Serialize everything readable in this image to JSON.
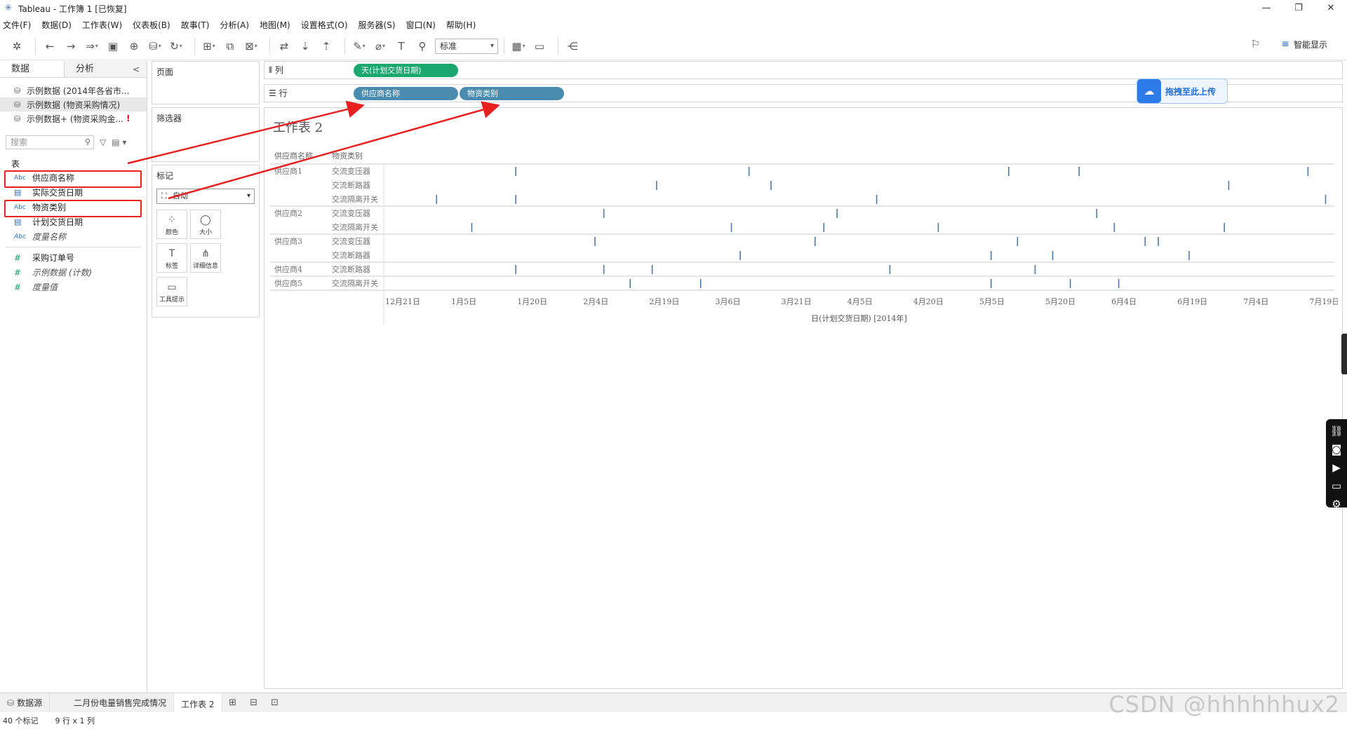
{
  "window": {
    "title": "Tableau - 工作簿 1 [已恢复]",
    "controls": [
      "—",
      "❐",
      "✕"
    ]
  },
  "menu": [
    "文件(F)",
    "数据(D)",
    "工作表(W)",
    "仪表板(B)",
    "故事(T)",
    "分析(A)",
    "地图(M)",
    "设置格式(O)",
    "服务器(S)",
    "窗口(N)",
    "帮助(H)"
  ],
  "toolbar": {
    "fit_select": "标准",
    "smart_show": "智能显示"
  },
  "datapanel": {
    "tab_data": "数据",
    "tab_analysis": "分析",
    "collapse": "<",
    "sources": [
      {
        "label": "示例数据 (2014年各省市...",
        "selected": false,
        "warn": ""
      },
      {
        "label": "示例数据 (物资采购情况)",
        "selected": true,
        "warn": ""
      },
      {
        "label": "示例数据+ (物资采购金...",
        "selected": false,
        "warn": "!"
      }
    ],
    "search_placeholder": "搜索",
    "section": "表",
    "dimensions": [
      {
        "type": "Abc",
        "label": "供应商名称",
        "highlight": true
      },
      {
        "type": "date",
        "label": "实际交货日期",
        "highlight": false
      },
      {
        "type": "Abc",
        "label": "物资类别",
        "highlight": true
      },
      {
        "type": "date",
        "label": "计划交货日期",
        "highlight": false
      },
      {
        "type": "Abc",
        "label": "度量名称",
        "highlight": false,
        "italic": true
      }
    ],
    "measures": [
      {
        "type": "#",
        "label": "采购订单号",
        "italic": false
      },
      {
        "type": "#",
        "label": "示例数据 (计数)",
        "italic": true
      },
      {
        "type": "#",
        "label": "度量值",
        "italic": true
      }
    ]
  },
  "cards": {
    "pages": "页面",
    "filters": "筛选器",
    "marks": "标记",
    "marks_type": "自动",
    "mark_buttons": [
      {
        "icon": "⁘",
        "label": "颜色"
      },
      {
        "icon": "◯",
        "label": "大小"
      },
      {
        "icon": "T",
        "label": "标签"
      },
      {
        "icon": "⋔",
        "label": "详细信息"
      },
      {
        "icon": "▭",
        "label": "工具提示"
      }
    ]
  },
  "shelves": {
    "columns_label": "列",
    "rows_label": "行",
    "columns_pills": [
      "天(计划交货日期)"
    ],
    "rows_pills": [
      "供应商名称",
      "物资类别"
    ]
  },
  "upload": {
    "label": "拖拽至此上传"
  },
  "sheet": {
    "title": "工作表 2",
    "header_supplier": "供应商名称",
    "header_category": "物资类别",
    "axis_title": "日(计划交货日期) [2014年]"
  },
  "chart_data": {
    "type": "scatter",
    "mark": "tick",
    "x_ticks": [
      "12月21日",
      "1月5日",
      "1月20日",
      "2月4日",
      "2月19日",
      "3月6日",
      "3月21日",
      "4月5日",
      "4月20日",
      "5月5日",
      "5月20日",
      "6月4日",
      "6月19日",
      "7月4日",
      "7月19日"
    ],
    "x_range": [
      "2013-12-21",
      "2014-07-25"
    ],
    "rows": [
      {
        "supplier": "供应商1",
        "category": "交流变压器",
        "dates": [
          "2014-01-20",
          "2014-03-14",
          "2014-05-12",
          "2014-05-28",
          "2014-07-19"
        ]
      },
      {
        "supplier": "",
        "category": "交流断路器",
        "dates": [
          "2014-02-21",
          "2014-03-19",
          "2014-07-01"
        ]
      },
      {
        "supplier": "",
        "category": "交流隔离开关",
        "dates": [
          "2014-01-02",
          "2014-01-20",
          "2014-04-12",
          "2014-07-23"
        ]
      },
      {
        "supplier": "供应商2",
        "category": "交流变压器",
        "dates": [
          "2014-02-09",
          "2014-04-03",
          "2014-06-01"
        ]
      },
      {
        "supplier": "",
        "category": "交流隔离开关",
        "dates": [
          "2014-01-10",
          "2014-03-10",
          "2014-03-31",
          "2014-04-26",
          "2014-06-05",
          "2014-06-30"
        ]
      },
      {
        "supplier": "供应商3",
        "category": "交流变压器",
        "dates": [
          "2014-02-07",
          "2014-03-29",
          "2014-05-14",
          "2014-06-12",
          "2014-06-15"
        ]
      },
      {
        "supplier": "",
        "category": "交流断路器",
        "dates": [
          "2014-03-12",
          "2014-05-08",
          "2014-05-22",
          "2014-06-22"
        ]
      },
      {
        "supplier": "供应商4",
        "category": "交流断路器",
        "dates": [
          "2014-01-20",
          "2014-02-09",
          "2014-02-20",
          "2014-04-15",
          "2014-05-18"
        ]
      },
      {
        "supplier": "供应商5",
        "category": "交流隔离开关",
        "dates": [
          "2014-02-15",
          "2014-03-03",
          "2014-05-08",
          "2014-05-26",
          "2014-06-06"
        ]
      }
    ],
    "tick_color": "#4e79a7"
  },
  "bottom": {
    "datasource": "数据源",
    "tabs": [
      "二月份电量销售完成情况",
      "工作表 2"
    ],
    "active_tab": "工作表 2"
  },
  "status": {
    "marks": "40 个标记",
    "dims": "9 行 x 1 列"
  },
  "watermark": "CSDN @hhhhhhux2"
}
